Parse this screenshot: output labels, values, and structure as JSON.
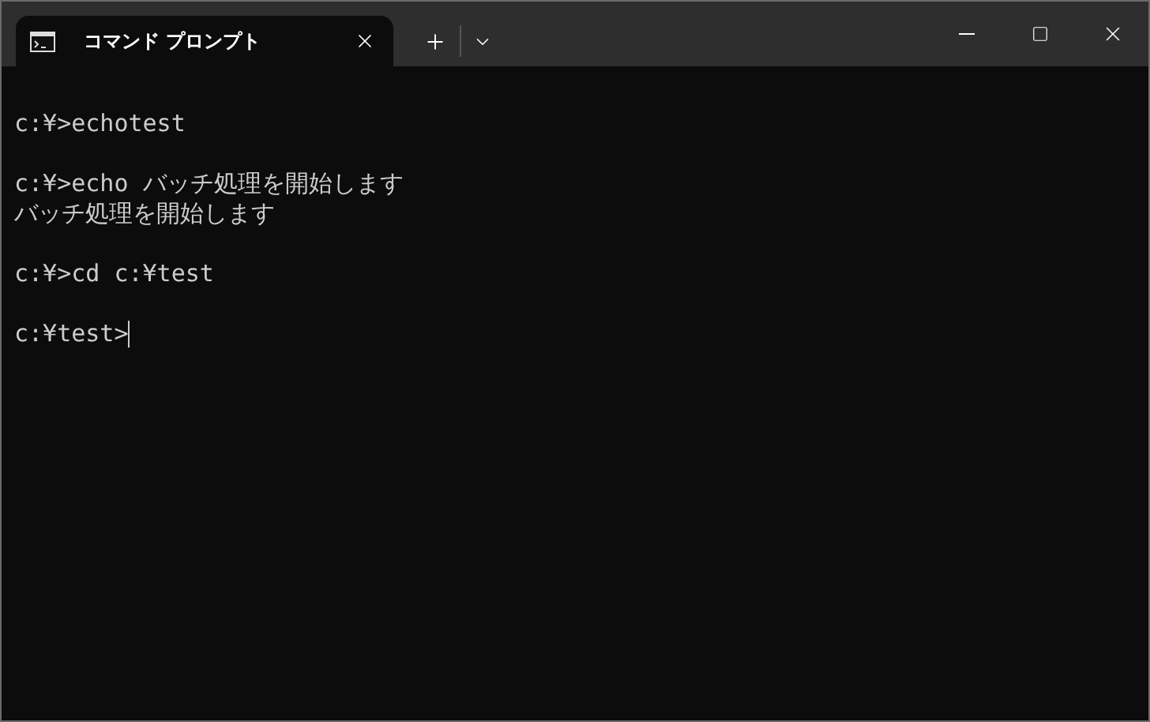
{
  "tab": {
    "title": "コマンド プロンプト",
    "selected": true
  },
  "terminal": {
    "blocks": [
      [
        "c:¥>echotest"
      ],
      [
        "c:¥>echo バッチ処理を開始します",
        "バッチ処理を開始します"
      ],
      [
        "c:¥>cd c:¥test"
      ]
    ],
    "prompt": "c:¥test>",
    "cursor": true
  }
}
